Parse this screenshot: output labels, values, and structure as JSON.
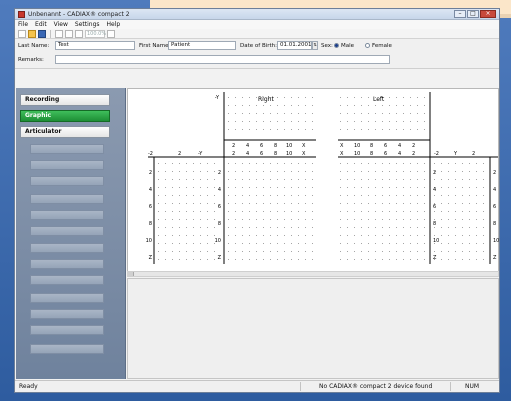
{
  "window": {
    "title": "Unbenannt - CADIAX® compact 2"
  },
  "menu": [
    "File",
    "Edit",
    "View",
    "Settings",
    "Help"
  ],
  "toolbar": {
    "zoom_value": "100.0%"
  },
  "patient": {
    "last_name_label": "Last Name:",
    "last_name_value": "Test",
    "first_name_label": "First Name:",
    "first_name_value": "Patient",
    "dob_label": "Date of Birth:",
    "dob_value": "01.01.2001",
    "sex_label": "Sex:",
    "sex_options": [
      "Male",
      "Female"
    ],
    "sex_selected": "Male",
    "remarks_label": "Remarks:",
    "remarks_value": ""
  },
  "sidebar": {
    "modes": [
      "Recording",
      "Graphic",
      "Articulator"
    ],
    "active_mode": "Graphic",
    "disabled_buttons_visible_text": ""
  },
  "graph": {
    "right_title": "Right",
    "left_title": "Left",
    "right_top_x_ticks": [
      "2",
      "4",
      "6",
      "8",
      "10",
      "X"
    ],
    "left_top_x_ticks": [
      "X",
      "10",
      "8",
      "6",
      "4",
      "2"
    ],
    "right_bottom_x_ticks": [
      "2",
      "4",
      "6",
      "8",
      "10",
      "X"
    ],
    "left_bottom_x_ticks": [
      "X",
      "10",
      "8",
      "6",
      "4",
      "2"
    ],
    "far_left_ticks": [
      "-2",
      "2",
      "-Y"
    ],
    "far_right_ticks": [
      "-2",
      "Y",
      "2"
    ],
    "y_axis_label": "-Y",
    "z_ticks": [
      "2",
      "4",
      "6",
      "8",
      "10",
      "Z"
    ]
  },
  "status": {
    "ready": "Ready",
    "device": "No CADIAX® compact 2 device found",
    "num": "NUM"
  }
}
